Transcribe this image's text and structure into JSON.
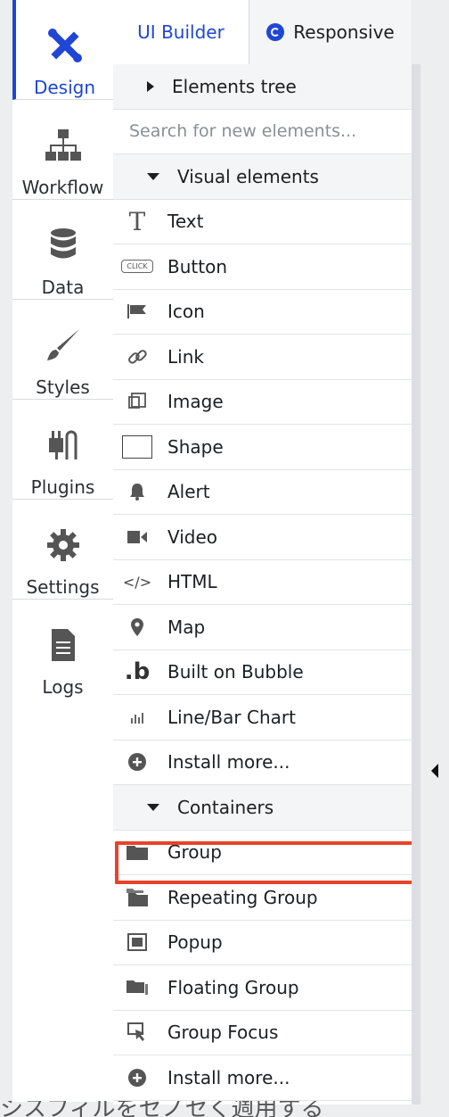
{
  "nav": {
    "items": [
      {
        "label": "Design",
        "icon": "design-tools-icon",
        "active": true
      },
      {
        "label": "Workflow",
        "icon": "workflow-sitemap-icon"
      },
      {
        "label": "Data",
        "icon": "database-icon"
      },
      {
        "label": "Styles",
        "icon": "paintbrush-icon"
      },
      {
        "label": "Plugins",
        "icon": "plugin-icon"
      },
      {
        "label": "Settings",
        "icon": "gear-icon"
      },
      {
        "label": "Logs",
        "icon": "document-icon"
      }
    ]
  },
  "tabs": {
    "ui_builder": "UI Builder",
    "responsive": "Responsive"
  },
  "panel": {
    "elements_tree": "Elements tree",
    "search_placeholder": "Search for new elements...",
    "visual_header": "Visual elements",
    "visual_items": [
      "Text",
      "Button",
      "Icon",
      "Link",
      "Image",
      "Shape",
      "Alert",
      "Video",
      "HTML",
      "Map",
      "Built on Bubble",
      "Line/Bar Chart",
      "Install more..."
    ],
    "containers_header": "Containers",
    "container_items": [
      "Group",
      "Repeating Group",
      "Popup",
      "Floating Group",
      "Group Focus",
      "Install more..."
    ],
    "click_badge": "CLICK",
    "html_glyph": "</>"
  },
  "colors": {
    "accent": "#1f46d4",
    "highlight": "#e8432a"
  },
  "bottom_text": "シスフィルをセノセく週用する"
}
